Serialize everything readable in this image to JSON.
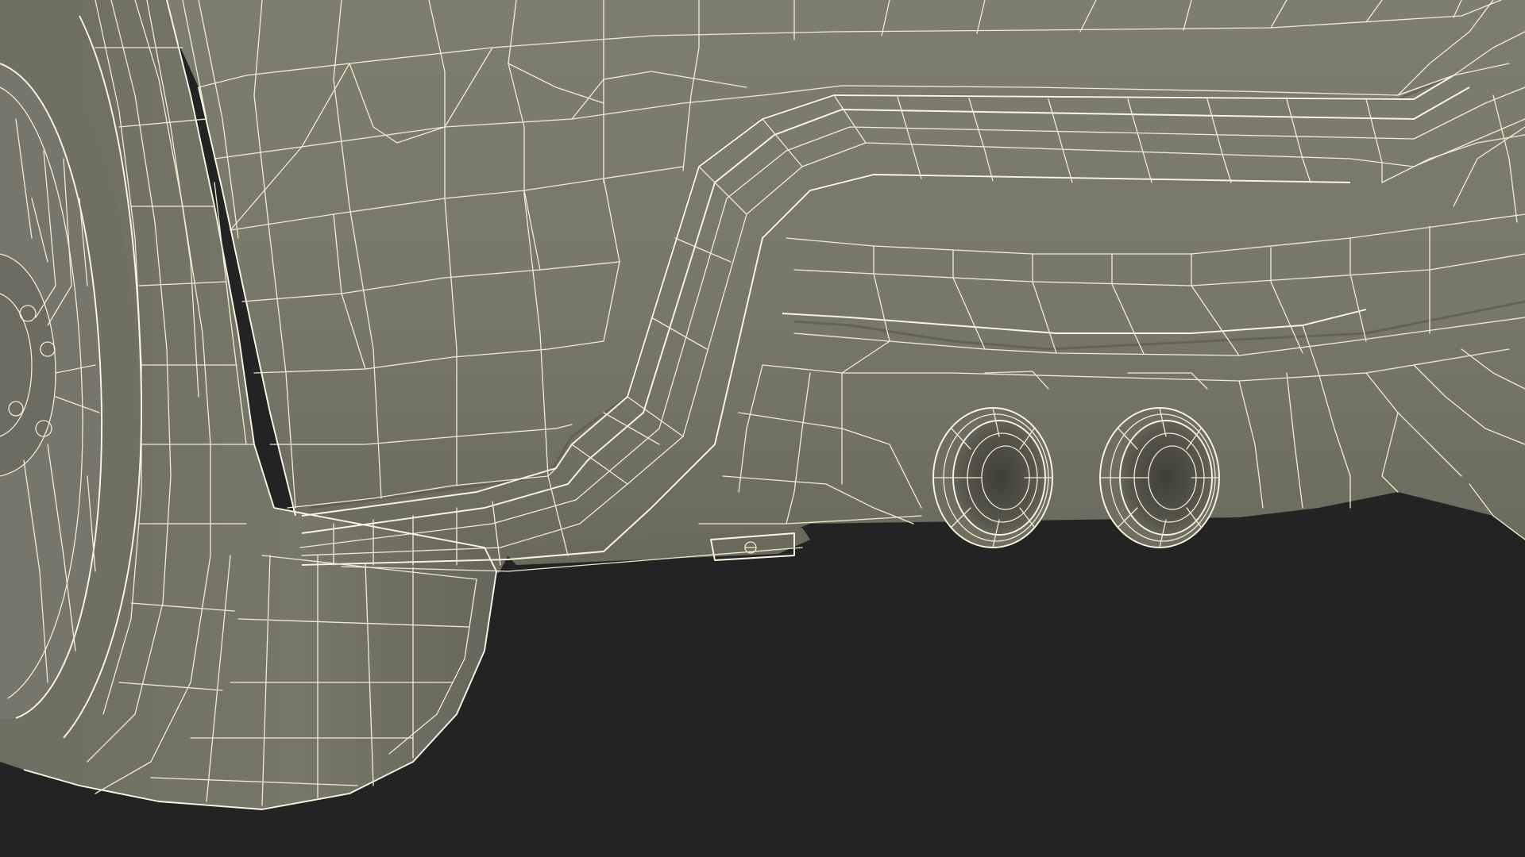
{
  "render": {
    "background_color": "#232323",
    "surface_color": "#7a7a6a",
    "wire_color": "#f2ecd2",
    "subject_icon": "car-rear-underside-wireframe"
  }
}
